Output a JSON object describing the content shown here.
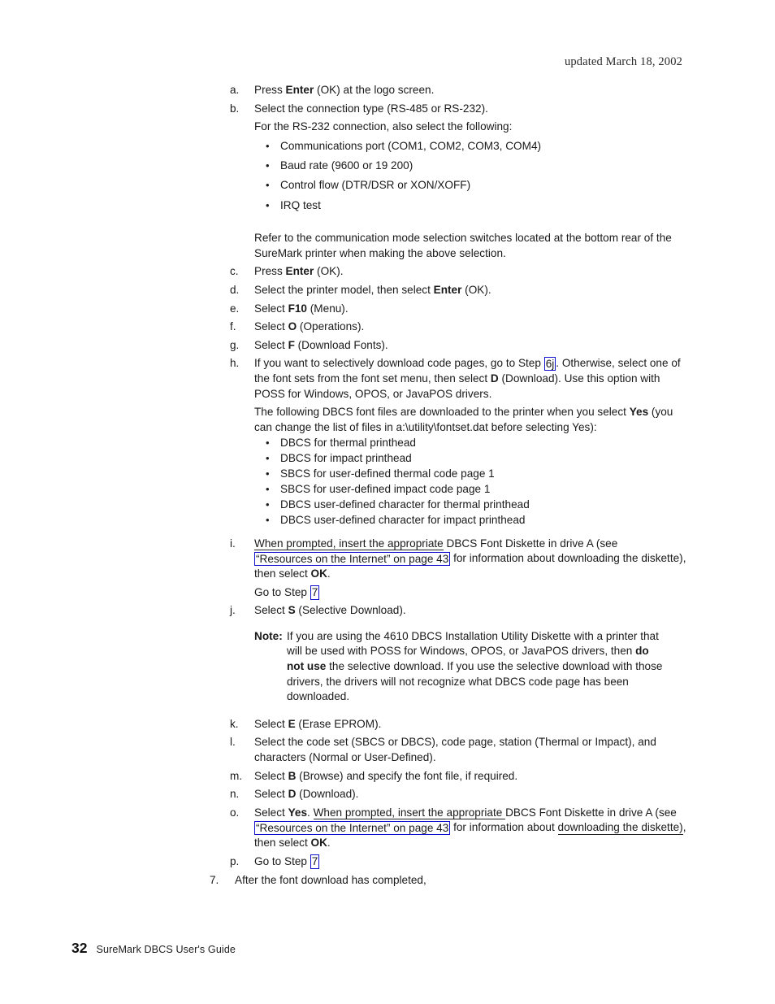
{
  "header": {
    "updated_note": "updated March 18, 2002"
  },
  "footer": {
    "page_number": "32",
    "guide_title": "SureMark DBCS User's Guide"
  },
  "links": {
    "step_6j": "6j",
    "step_7": "7",
    "resources_internet": "“Resources on the Internet” on page 43",
    "color": "#1111cc"
  },
  "steps": {
    "a": {
      "marker": "a.",
      "t1": "Press ",
      "b1": "Enter",
      "t2": " (OK) at the logo screen."
    },
    "b": {
      "marker": "b.",
      "t1": "Select the connection type (RS-485 or RS-232).",
      "cont": "For the RS-232 connection, also select the following:",
      "bullets": [
        "Communications port (COM1, COM2, COM3, COM4)",
        "Baud rate (9600 or 19 200)",
        "Control flow (DTR/DSR or XON/XOFF)",
        "IRQ test"
      ],
      "refer": "Refer to the communication mode selection switches located at the bottom rear of the SureMark printer when making the above selection."
    },
    "c": {
      "marker": "c.",
      "t1": "Press ",
      "b1": "Enter",
      "t2": " (OK)."
    },
    "d": {
      "marker": "d.",
      "t1": "Select the printer model, then select ",
      "b1": "Enter",
      "t2": " (OK)."
    },
    "e": {
      "marker": "e.",
      "t1": "Select ",
      "b1": "F10",
      "t2": " (Menu)."
    },
    "f": {
      "marker": "f.",
      "t1": "Select ",
      "b1": "O",
      "t2": " (Operations)."
    },
    "g": {
      "marker": "g.",
      "t1": "Select ",
      "b1": "F",
      "t2": " (Download Fonts)."
    },
    "h": {
      "marker": "h.",
      "t1": "If you want to selectively download code pages, go to Step ",
      "t2": ". Otherwise, select one of the font sets from the font set menu, then select ",
      "b1": "D",
      "t3": " (Download). Use this option with POSS for Windows, OPOS, or JavaPOS drivers.",
      "cont_t1": "The following DBCS font files are downloaded to the printer when you select ",
      "cont_b1": "Yes",
      "cont_t2": " (you can change the list of files in a:\\utility\\fontset.dat before selecting Yes):",
      "bullets": [
        "DBCS for thermal printhead",
        "DBCS for impact printhead",
        "SBCS for user-defined thermal code page 1",
        "SBCS for user-defined impact code page 1",
        "DBCS user-defined character for thermal printhead",
        "DBCS user-defined character for impact printhead"
      ]
    },
    "i": {
      "marker": "i.",
      "t1": "When prompted, insert the appropriate",
      "t2": " DBCS Font Diskette in drive A (see ",
      "t3": " for information about downloading the diskette), then select ",
      "b1": "OK",
      "t4": ".",
      "goto_t1": "Go to Step "
    },
    "j": {
      "marker": "j.",
      "t1": "Select ",
      "b1": "S",
      "t2": " (Selective Download)."
    },
    "note": {
      "label": "Note:",
      "t1": "If you are using the 4610 DBCS Installation Utility Diskette with a printer that will be used with POSS for Windows, OPOS, or JavaPOS drivers, then ",
      "b1": "do not use",
      "t2": " the selective download. If you use the selective download with those drivers, the drivers will not recognize what DBCS code page has been downloaded."
    },
    "k": {
      "marker": "k.",
      "t1": "Select ",
      "b1": "E",
      "t2": " (Erase EPROM)."
    },
    "l": {
      "marker": "l.",
      "t1": "Select the code set (SBCS or DBCS), code page, station (Thermal or Impact), and characters (Normal or User-Defined)."
    },
    "m": {
      "marker": "m.",
      "t1": "Select ",
      "b1": "B",
      "t2": " (Browse) and specify the font file, if required."
    },
    "n": {
      "marker": "n.",
      "t1": "Select ",
      "b1": "D",
      "t2": " (Download)."
    },
    "o": {
      "marker": "o.",
      "t1": "Select ",
      "b1": "Yes",
      "t2": ". ",
      "t3": "When prompted, insert the appropriate ",
      "t4": "DBCS Font Diskette in drive A (see ",
      "t5": " for information about ",
      "t6": "downloading the diskette)",
      "t7": ", then select ",
      "b2": "OK",
      "t8": "."
    },
    "p": {
      "marker": "p.",
      "t1": "Go to Step "
    },
    "seven": {
      "marker": "7.",
      "t1": "After the font download has completed,"
    }
  }
}
